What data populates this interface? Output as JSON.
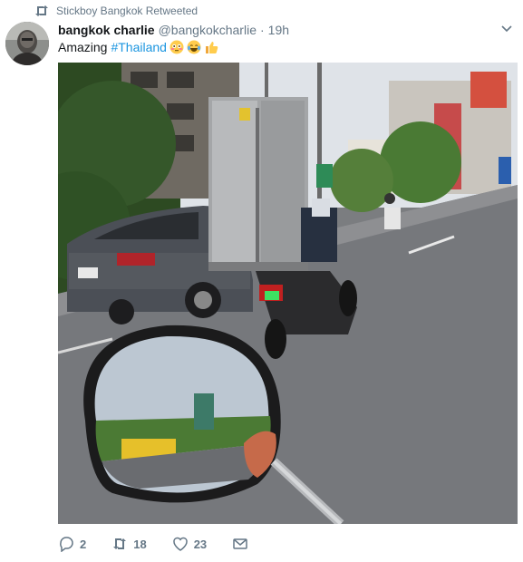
{
  "retweet_context": {
    "text": "Stickboy Bangkok Retweeted",
    "icon": "retweet-icon"
  },
  "tweet": {
    "display_name": "bangkok charlie",
    "handle": "@bangkokcharlie",
    "separator": "·",
    "time": "19h",
    "text": "Amazing",
    "hashtag": "#Thailand",
    "emojis": [
      "flushed-face-emoji",
      "tears-of-joy-emoji",
      "thumbs-up-emoji"
    ]
  },
  "actions": {
    "reply_count": "2",
    "retweet_count": "18",
    "like_count": "23"
  },
  "colors": {
    "link": "#1b95e0",
    "secondary": "#657786",
    "primary_text": "#14171a"
  }
}
